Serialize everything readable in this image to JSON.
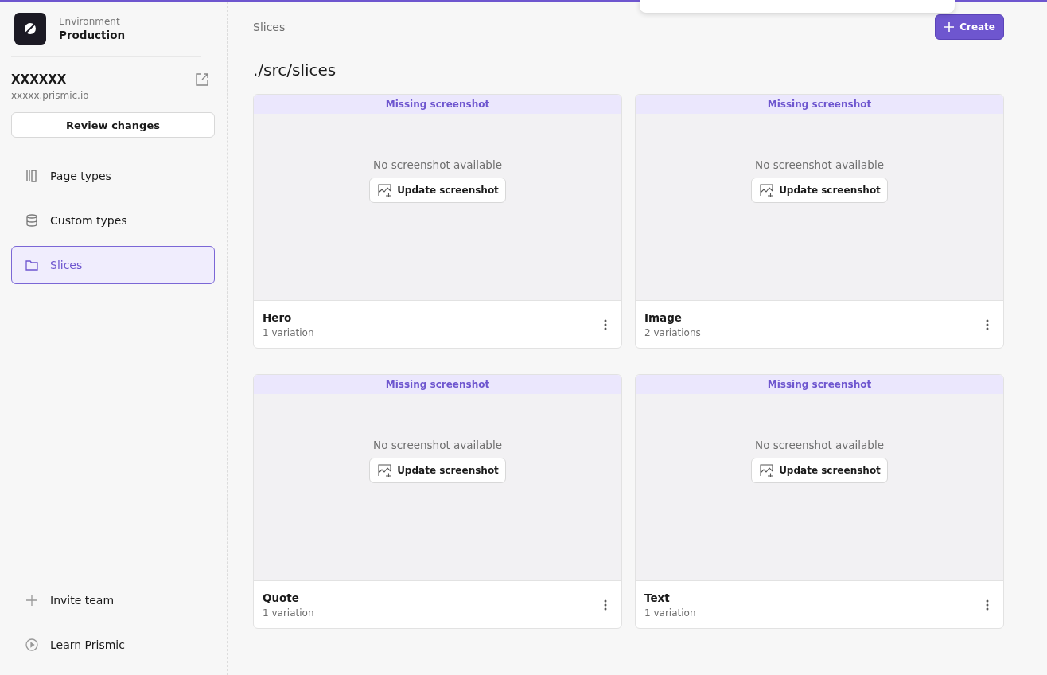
{
  "environment": {
    "label": "Environment",
    "name": "Production"
  },
  "repository": {
    "name": "XXXXXX",
    "url": "xxxxx.prismic.io"
  },
  "review_button": "Review changes",
  "nav": [
    {
      "label": "Page types",
      "kind": "columns",
      "selected": false
    },
    {
      "label": "Custom types",
      "kind": "database",
      "selected": false
    },
    {
      "label": "Slices",
      "kind": "folder",
      "selected": true
    }
  ],
  "footer_nav": [
    {
      "label": "Invite team",
      "kind": "plus"
    },
    {
      "label": "Learn Prismic",
      "kind": "play"
    }
  ],
  "breadcrumb": "Slices",
  "create_button": "Create",
  "heading": "./src/slices",
  "slices": [
    {
      "banner": "Missing screenshot",
      "empty_text": "No screenshot available",
      "update_button": "Update screenshot",
      "name": "Hero",
      "variations": "1 variation"
    },
    {
      "banner": "Missing screenshot",
      "empty_text": "No screenshot available",
      "update_button": "Update screenshot",
      "name": "Image",
      "variations": "2 variations"
    },
    {
      "banner": "Missing screenshot",
      "empty_text": "No screenshot available",
      "update_button": "Update screenshot",
      "name": "Quote",
      "variations": "1 variation"
    },
    {
      "banner": "Missing screenshot",
      "empty_text": "No screenshot available",
      "update_button": "Update screenshot",
      "name": "Text",
      "variations": "1 variation"
    }
  ]
}
